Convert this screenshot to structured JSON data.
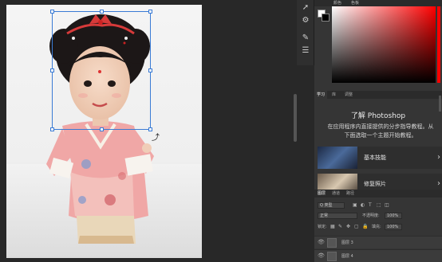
{
  "toolbar": {
    "icons": [
      "pen-cursor-icon",
      "adjust-icon",
      "brush-icon",
      "sliders-icon"
    ]
  },
  "color_panel": {
    "tabs": [
      "颜色",
      "色板"
    ],
    "foreground": "#ffffff",
    "background": "#000000",
    "hue": "#ff0000"
  },
  "learn_panel": {
    "tabs": [
      "学习",
      "库",
      "调整"
    ],
    "title": "了解 Photoshop",
    "description_line1": "在应用程序内直接提供的分步指导教程。从",
    "description_line2": "下面选取一个主题开始教程。",
    "cards": [
      {
        "label": "基本技能"
      },
      {
        "label": "修复照片"
      }
    ]
  },
  "layers_panel": {
    "tabs": [
      "图层",
      "通道",
      "路径"
    ],
    "filter_label": "Q 类型",
    "blend_mode": "正常",
    "opacity_label": "不透明度:",
    "opacity_value": "100%",
    "lock_label": "锁定:",
    "fill_label": "填充:",
    "fill_value": "100%",
    "layers": [
      {
        "name": "图层 3"
      },
      {
        "name": "图层 4"
      }
    ]
  },
  "colors": {
    "accent": "#3a7bd5",
    "panel_bg": "#353535",
    "app_bg": "#282828"
  }
}
